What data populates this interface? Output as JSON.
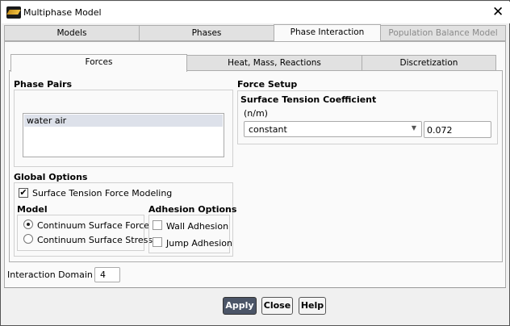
{
  "window": {
    "title": "Multiphase Model",
    "close_icon": "close-icon"
  },
  "top_tabs": [
    {
      "label": "Models"
    },
    {
      "label": "Phases"
    },
    {
      "label": "Phase Interaction",
      "active": true
    },
    {
      "label": "Population Balance Model",
      "disabled": true
    }
  ],
  "sub_tabs": [
    {
      "label": "Forces",
      "active": true
    },
    {
      "label": "Heat, Mass, Reactions"
    },
    {
      "label": "Discretization"
    }
  ],
  "phase_pairs": {
    "label": "Phase Pairs",
    "items": [
      {
        "label": "water air",
        "selected": true
      }
    ]
  },
  "force_setup": {
    "label": "Force Setup",
    "coefficient_label": "Surface Tension Coefficient",
    "units": "(n/m)",
    "method": "constant",
    "value": "0.072"
  },
  "global_options": {
    "label": "Global Options",
    "surface_tension_label": "Surface Tension Force Modeling",
    "surface_tension_checked": true,
    "model": {
      "label": "Model",
      "options": [
        {
          "label": "Continuum Surface Force",
          "selected": true
        },
        {
          "label": "Continuum Surface Stress",
          "selected": false
        }
      ]
    },
    "adhesion": {
      "label": "Adhesion Options",
      "options": [
        {
          "label": "Wall Adhesion",
          "checked": false
        },
        {
          "label": "Jump Adhesion",
          "checked": false
        }
      ]
    }
  },
  "interaction_domain": {
    "label": "Interaction Domain ID",
    "value": "4"
  },
  "buttons": {
    "apply": "Apply",
    "close": "Close",
    "help": "Help"
  },
  "colors": {
    "apply_bg": "#4b5567",
    "selected_row": "#dde1ea"
  }
}
